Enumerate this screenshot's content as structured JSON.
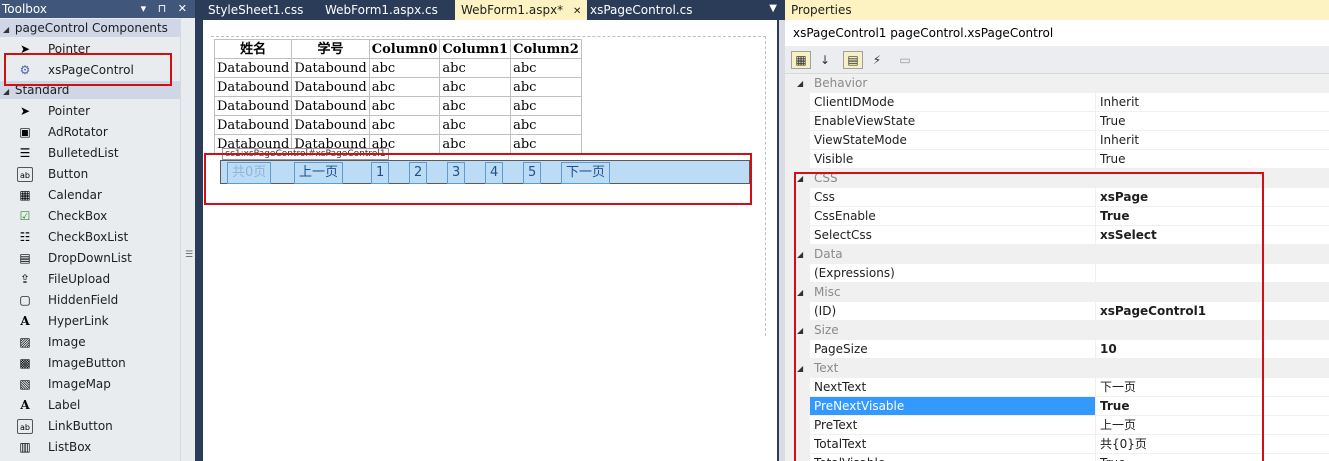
{
  "toolbox": {
    "title": "Toolbox",
    "title_controls": "▾ ⊓ ✕",
    "groups": [
      {
        "label": "pageControl Components"
      },
      {
        "label": "Standard"
      }
    ],
    "custom_items": [
      {
        "label": "Pointer",
        "icon": "pointer-icon"
      },
      {
        "label": "xsPageControl",
        "icon": "gear-icon"
      }
    ],
    "items": [
      {
        "label": "Pointer",
        "icon": "pointer-icon"
      },
      {
        "label": "AdRotator",
        "icon": "adrotator-icon"
      },
      {
        "label": "BulletedList",
        "icon": "bulleted-list-icon"
      },
      {
        "label": "Button",
        "icon": "button-icon"
      },
      {
        "label": "Calendar",
        "icon": "calendar-icon"
      },
      {
        "label": "CheckBox",
        "icon": "checkbox-icon"
      },
      {
        "label": "CheckBoxList",
        "icon": "checkbox-list-icon"
      },
      {
        "label": "DropDownList",
        "icon": "dropdown-list-icon"
      },
      {
        "label": "FileUpload",
        "icon": "file-upload-icon"
      },
      {
        "label": "HiddenField",
        "icon": "hidden-field-icon"
      },
      {
        "label": "HyperLink",
        "icon": "hyperlink-icon"
      },
      {
        "label": "Image",
        "icon": "image-icon"
      },
      {
        "label": "ImageButton",
        "icon": "image-button-icon"
      },
      {
        "label": "ImageMap",
        "icon": "image-map-icon"
      },
      {
        "label": "Label",
        "icon": "label-icon"
      },
      {
        "label": "LinkButton",
        "icon": "link-button-icon"
      },
      {
        "label": "ListBox",
        "icon": "listbox-icon"
      }
    ]
  },
  "editor": {
    "tabs": [
      {
        "label": "StyleSheet1.css",
        "active": false
      },
      {
        "label": "WebForm1.aspx.cs",
        "active": false
      },
      {
        "label": "WebForm1.aspx*",
        "active": true
      },
      {
        "label": "xsPageControl.cs",
        "active": false
      }
    ],
    "tab_close": "✕",
    "tab_dropdown": "▼",
    "grid": {
      "headers": [
        "姓名",
        "学号",
        "Column0",
        "Column1",
        "Column2"
      ],
      "rows": [
        [
          "Databound",
          "Databound",
          "abc",
          "abc",
          "abc"
        ],
        [
          "Databound",
          "Databound",
          "abc",
          "abc",
          "abc"
        ],
        [
          "Databound",
          "Databound",
          "abc",
          "abc",
          "abc"
        ],
        [
          "Databound",
          "Databound",
          "abc",
          "abc",
          "abc"
        ],
        [
          "Databound",
          "Databound",
          "abc",
          "abc",
          "abc"
        ]
      ]
    },
    "control_tag": "cc1:xsPageControl#xsPageControl1",
    "pager": {
      "total": "共0页",
      "prev": "上一页",
      "pages": [
        "1",
        "2",
        "3",
        "4",
        "5"
      ],
      "next": "下一页"
    }
  },
  "properties": {
    "title": "Properties",
    "object_name": "xsPageControl1",
    "object_type": "pageControl.xsPageControl",
    "toolbar": [
      "categorized-icon",
      "alphabetical-icon",
      "properties-icon",
      "events-icon",
      "property-pages-icon"
    ],
    "sections": [
      {
        "category": "Behavior",
        "rows": [
          {
            "name": "ClientIDMode",
            "value": "Inherit",
            "bold": false
          },
          {
            "name": "EnableViewState",
            "value": "True",
            "bold": false
          },
          {
            "name": "ViewStateMode",
            "value": "Inherit",
            "bold": false
          },
          {
            "name": "Visible",
            "value": "True",
            "bold": false
          }
        ]
      },
      {
        "category": "CSS",
        "rows": [
          {
            "name": "Css",
            "value": "xsPage",
            "bold": true
          },
          {
            "name": "CssEnable",
            "value": "True",
            "bold": true
          },
          {
            "name": "SelectCss",
            "value": "xsSelect",
            "bold": true
          }
        ]
      },
      {
        "category": "Data",
        "rows": [
          {
            "name": "(Expressions)",
            "value": "",
            "bold": false
          }
        ]
      },
      {
        "category": "Misc",
        "rows": [
          {
            "name": "(ID)",
            "value": "xsPageControl1",
            "bold": true
          }
        ]
      },
      {
        "category": "Size",
        "rows": [
          {
            "name": "PageSize",
            "value": "10",
            "bold": true
          }
        ]
      },
      {
        "category": "Text",
        "rows": [
          {
            "name": "NextText",
            "value": "下一页",
            "bold": false
          },
          {
            "name": "PreNextVisable",
            "value": "True",
            "bold": true,
            "selected": true
          },
          {
            "name": "PreText",
            "value": "上一页",
            "bold": false
          },
          {
            "name": "TotalText",
            "value": "共{0}页",
            "bold": false
          },
          {
            "name": "TotalVisable",
            "value": "True",
            "bold": false
          }
        ]
      }
    ]
  },
  "colors": {
    "highlight_box": "#d20f12",
    "selection": "#3399ff",
    "pager_bg": "#bcdcf5"
  }
}
